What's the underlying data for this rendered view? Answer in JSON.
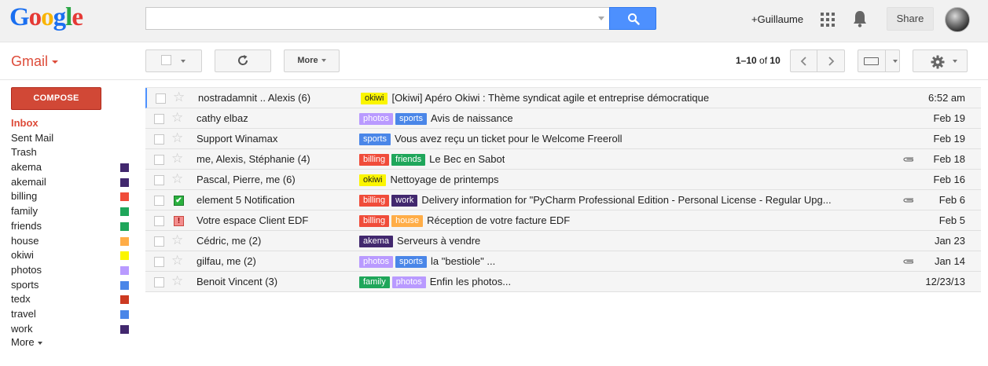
{
  "header": {
    "logo_letters": [
      {
        "ch": "G",
        "color": "#1a6ff0"
      },
      {
        "ch": "o",
        "color": "#e53935"
      },
      {
        "ch": "o",
        "color": "#f9b400"
      },
      {
        "ch": "g",
        "color": "#1a6ff0"
      },
      {
        "ch": "l",
        "color": "#2aa645"
      },
      {
        "ch": "e",
        "color": "#e53935"
      }
    ],
    "search_value": "",
    "user_link": "+Guillaume",
    "share_label": "Share"
  },
  "toolbar": {
    "app_label": "Gmail",
    "more_label": "More",
    "page_range": "1–10",
    "page_of": "of",
    "page_total": "10"
  },
  "sidebar": {
    "compose_label": "COMPOSE",
    "folders": [
      {
        "label": "Inbox",
        "active": true
      },
      {
        "label": "Sent Mail"
      },
      {
        "label": "Trash"
      },
      {
        "label": "akema",
        "color": "#42286e"
      },
      {
        "label": "akemail",
        "color": "#42286e"
      },
      {
        "label": "billing",
        "color": "#f04c3a"
      },
      {
        "label": "family",
        "color": "#1fa65a"
      },
      {
        "label": "friends",
        "color": "#1fa65a"
      },
      {
        "label": "house",
        "color": "#ffad47"
      },
      {
        "label": "okiwi",
        "color": "#fbf500"
      },
      {
        "label": "photos",
        "color": "#b99aff"
      },
      {
        "label": "sports",
        "color": "#4a86e8"
      },
      {
        "label": "tedx",
        "color": "#cc3a21"
      },
      {
        "label": "travel",
        "color": "#4a86e8"
      },
      {
        "label": "work",
        "color": "#42286e"
      }
    ],
    "more_label": "More"
  },
  "tag_styles": {
    "okiwi": {
      "bg": "#fbf500",
      "fg": "#222222"
    },
    "photos": {
      "bg": "#b99aff",
      "fg": "#ffffff"
    },
    "sports": {
      "bg": "#4a86e8",
      "fg": "#ffffff"
    },
    "billing": {
      "bg": "#f04c3a",
      "fg": "#ffffff"
    },
    "friends": {
      "bg": "#1fa65a",
      "fg": "#ffffff"
    },
    "work": {
      "bg": "#42286e",
      "fg": "#ffffff"
    },
    "house": {
      "bg": "#ffad47",
      "fg": "#ffffff"
    },
    "akema": {
      "bg": "#42286e",
      "fg": "#ffffff"
    },
    "family": {
      "bg": "#1fa65a",
      "fg": "#ffffff"
    }
  },
  "emails": [
    {
      "sender": "nostradamnit .. Alexis (6)",
      "tags": [
        "okiwi"
      ],
      "subject": "[Okiwi] Apéro Okiwi : Thème syndicat agile et entreprise démocratique",
      "date": "6:52 am",
      "attachment": false,
      "marker": "star",
      "focused": true
    },
    {
      "sender": "cathy elbaz",
      "tags": [
        "photos",
        "sports"
      ],
      "subject": "Avis de naissance",
      "date": "Feb 19",
      "attachment": false,
      "marker": "star"
    },
    {
      "sender": "Support Winamax",
      "tags": [
        "sports"
      ],
      "subject": "Vous avez reçu un ticket pour le Welcome Freeroll",
      "date": "Feb 19",
      "attachment": false,
      "marker": "star"
    },
    {
      "sender": "me, Alexis, Stéphanie (4)",
      "tags": [
        "billing",
        "friends"
      ],
      "subject": "Le Bec en Sabot",
      "date": "Feb 18",
      "attachment": true,
      "marker": "star"
    },
    {
      "sender": "Pascal, Pierre, me (6)",
      "tags": [
        "okiwi"
      ],
      "subject": "Nettoyage de printemps",
      "date": "Feb 16",
      "attachment": false,
      "marker": "star"
    },
    {
      "sender": "element 5 Notification",
      "tags": [
        "billing",
        "work"
      ],
      "subject": "Delivery information for \"PyCharm Professional Edition - Personal License - Regular Upg...",
      "date": "Feb 6",
      "attachment": true,
      "marker": "check"
    },
    {
      "sender": "Votre espace Client EDF",
      "tags": [
        "billing",
        "house"
      ],
      "subject": "Réception de votre facture EDF",
      "date": "Feb 5",
      "attachment": false,
      "marker": "important"
    },
    {
      "sender": "Cédric, me (2)",
      "tags": [
        "akema"
      ],
      "subject": "Serveurs à vendre",
      "date": "Jan 23",
      "attachment": false,
      "marker": "star"
    },
    {
      "sender": "gilfau, me (2)",
      "tags": [
        "photos",
        "sports"
      ],
      "subject": "la \"bestiole\" ...",
      "date": "Jan 14",
      "attachment": true,
      "marker": "star"
    },
    {
      "sender": "Benoit Vincent (3)",
      "tags": [
        "family",
        "photos"
      ],
      "subject": "Enfin les photos...",
      "date": "12/23/13",
      "attachment": false,
      "marker": "star"
    }
  ]
}
